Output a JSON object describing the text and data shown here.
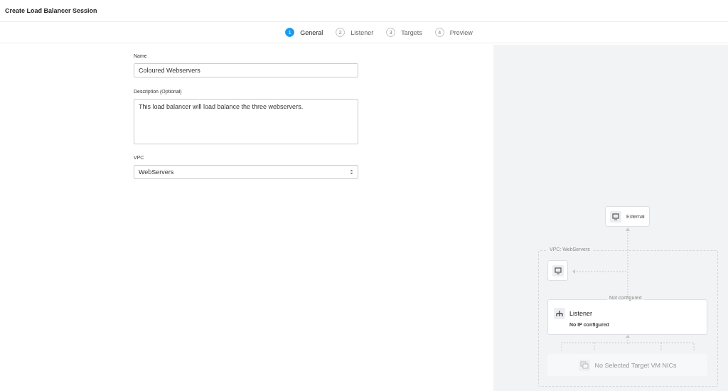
{
  "window": {
    "title": "Create Load Balancer Session"
  },
  "steps": [
    {
      "number": "1",
      "label": "General",
      "selected": true
    },
    {
      "number": "2",
      "label": "Listener",
      "selected": false
    },
    {
      "number": "3",
      "label": "Targets",
      "selected": false
    },
    {
      "number": "4",
      "label": "Preview",
      "selected": false
    }
  ],
  "form": {
    "name": {
      "label": "Name",
      "value": "Coloured Webservers"
    },
    "description": {
      "label": "Description (Optional)",
      "value": "This load balancer will load balance the three webservers."
    },
    "vpc": {
      "label": "VPC",
      "value": "WebServers"
    }
  },
  "diagram": {
    "external": "External",
    "vpc_label": "VPC: WebServers",
    "listener_status": "Not configured",
    "listener_title": "Listener",
    "listener_ip": "No IP configured",
    "targets": "No Selected Target VM NICs"
  }
}
